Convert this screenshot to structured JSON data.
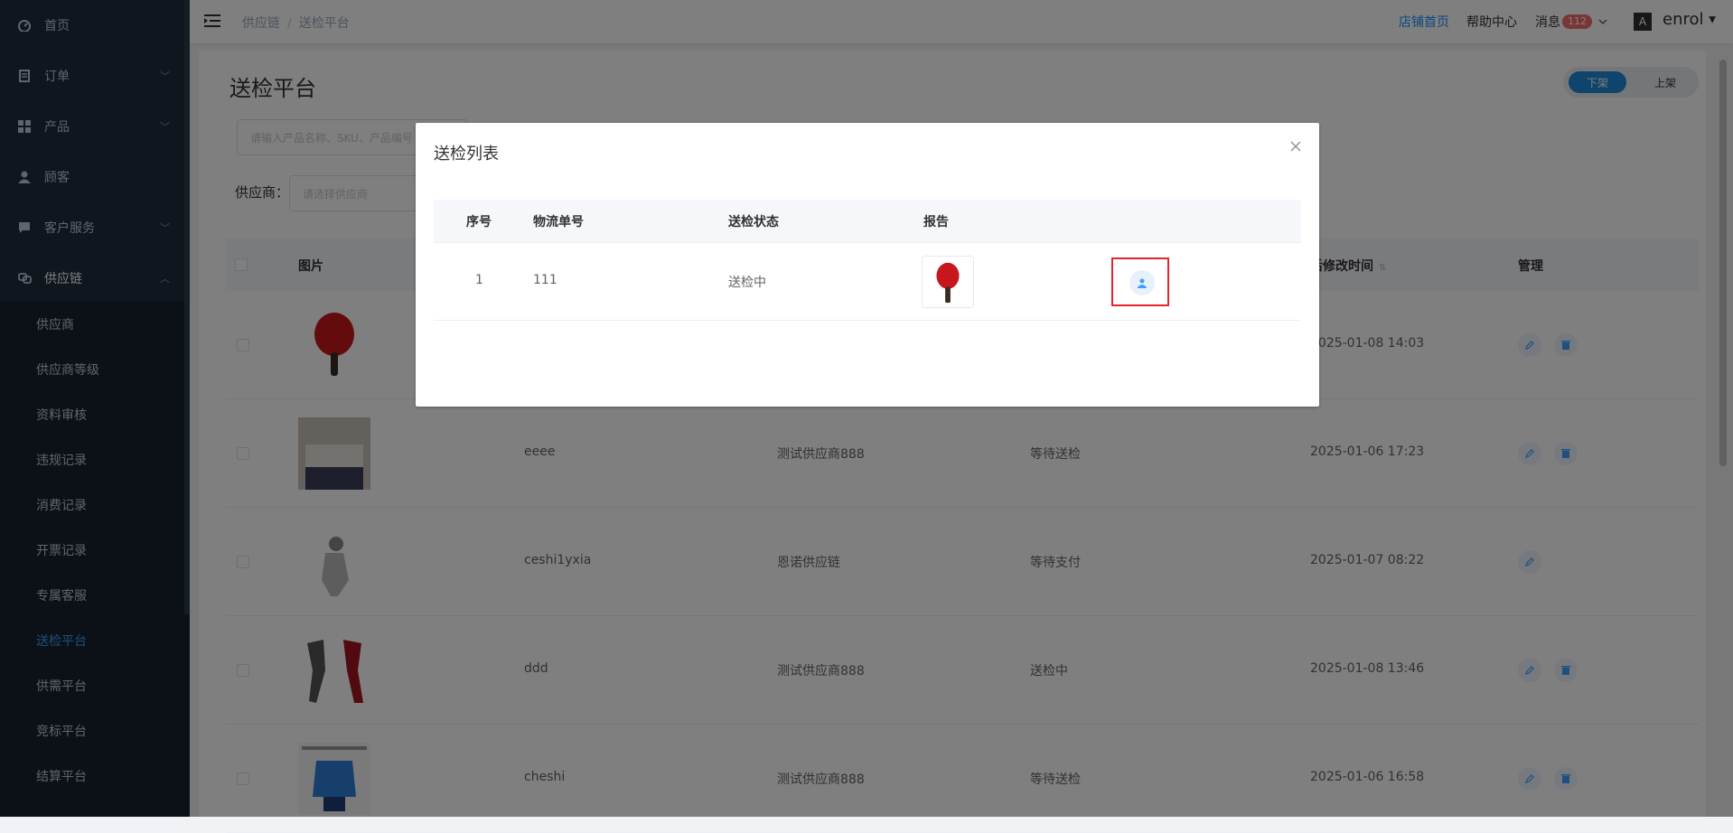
{
  "sidebar": {
    "items": [
      {
        "label": "首页",
        "icon": "dashboard-icon",
        "has_chevron": false
      },
      {
        "label": "订单",
        "icon": "order-icon",
        "chevron": "﹀"
      },
      {
        "label": "产品",
        "icon": "grid-icon",
        "chevron": "﹀"
      },
      {
        "label": "顾客",
        "icon": "user-icon",
        "chevron": ""
      },
      {
        "label": "客户服务",
        "icon": "chat-icon",
        "chevron": "﹀"
      },
      {
        "label": "供应链",
        "icon": "link-icon",
        "chevron": "︿"
      }
    ],
    "submenu": [
      "供应商",
      "供应商等级",
      "资料审核",
      "违规记录",
      "消费记录",
      "开票记录",
      "专属客服",
      "送检平台",
      "供需平台",
      "竞标平台",
      "结算平台"
    ],
    "active_sub": "送检平台",
    "colors": {
      "bg": "#1f2d3d",
      "active": "#409eff"
    }
  },
  "header": {
    "breadcrumb": [
      "供应链",
      "送检平台"
    ],
    "shop_home": "店铺首页",
    "help": "帮助中心",
    "messages": "消息",
    "message_count": "112",
    "user": "enrol"
  },
  "page": {
    "title": "送检平台",
    "toggle_on": "下架",
    "toggle_off": "上架",
    "search_placeholder": "请输入产品名称、SKU、产品编号",
    "supplier_label": "供应商：",
    "supplier_placeholder": "请选择供应商",
    "columns": {
      "image": "图片",
      "modified": "后修改时间",
      "manage": "管理"
    },
    "rows": [
      {
        "name": "",
        "supplier": "",
        "status": "",
        "time": "2025-01-08 14:03",
        "thumb": "paddle",
        "has_delete": true
      },
      {
        "name": "eeee",
        "supplier": "测试供应商888",
        "status": "等待送检",
        "time": "2025-01-06 17:23",
        "thumb": "bed",
        "has_delete": true
      },
      {
        "name": "ceshi1yxia",
        "supplier": "恩诺供应链",
        "status": "等待支付",
        "time": "2025-01-07 08:22",
        "thumb": "figure",
        "has_delete": false
      },
      {
        "name": "ddd",
        "supplier": "测试供应商888",
        "status": "送检中",
        "time": "2025-01-08 13:46",
        "thumb": "leggings",
        "has_delete": true
      },
      {
        "name": "cheshi",
        "supplier": "测试供应商888",
        "status": "等待送检",
        "time": "2025-01-06 16:58",
        "thumb": "glove",
        "has_delete": true
      }
    ]
  },
  "modal": {
    "title": "送检列表",
    "columns": [
      "序号",
      "物流单号",
      "送检状态",
      "报告"
    ],
    "row": {
      "index": "1",
      "tracking": "111",
      "status": "送检中"
    }
  }
}
